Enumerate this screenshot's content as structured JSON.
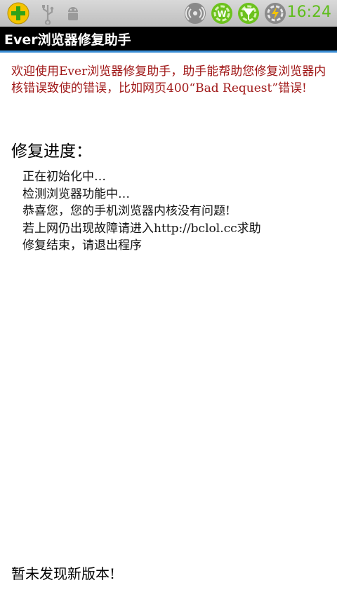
{
  "status_bar": {
    "time": "16:24",
    "icons": [
      "plus-app-icon",
      "usb-icon",
      "android-debug-icon",
      "wifi-hotspot-icon",
      "wifi-toggle-icon",
      "signal-toggle-icon",
      "battery-charging-icon"
    ]
  },
  "app": {
    "title": "Ever浏览器修复助手"
  },
  "intro": {
    "text": "欢迎使用Ever浏览器修复助手，助手能帮助您修复浏览器内核错误致使的错误，比如网页400“Bad Request”错误!"
  },
  "progress": {
    "title": "修复进度：",
    "log": [
      "正在初始化中…",
      "检测浏览器功能中…",
      "恭喜您，您的手机浏览器内核没有问题!",
      "若上网仍出现故障请进入http://bclol.cc求助",
      "修复结束，请退出程序"
    ]
  },
  "footer": {
    "text": "暂未发现新版本!"
  },
  "colors": {
    "status_bar": "#c8c8c8",
    "title_bar": "#000000",
    "title_accent": "#3b8fd6",
    "intro_text": "#a01818",
    "time_text": "#5ebd1b"
  }
}
